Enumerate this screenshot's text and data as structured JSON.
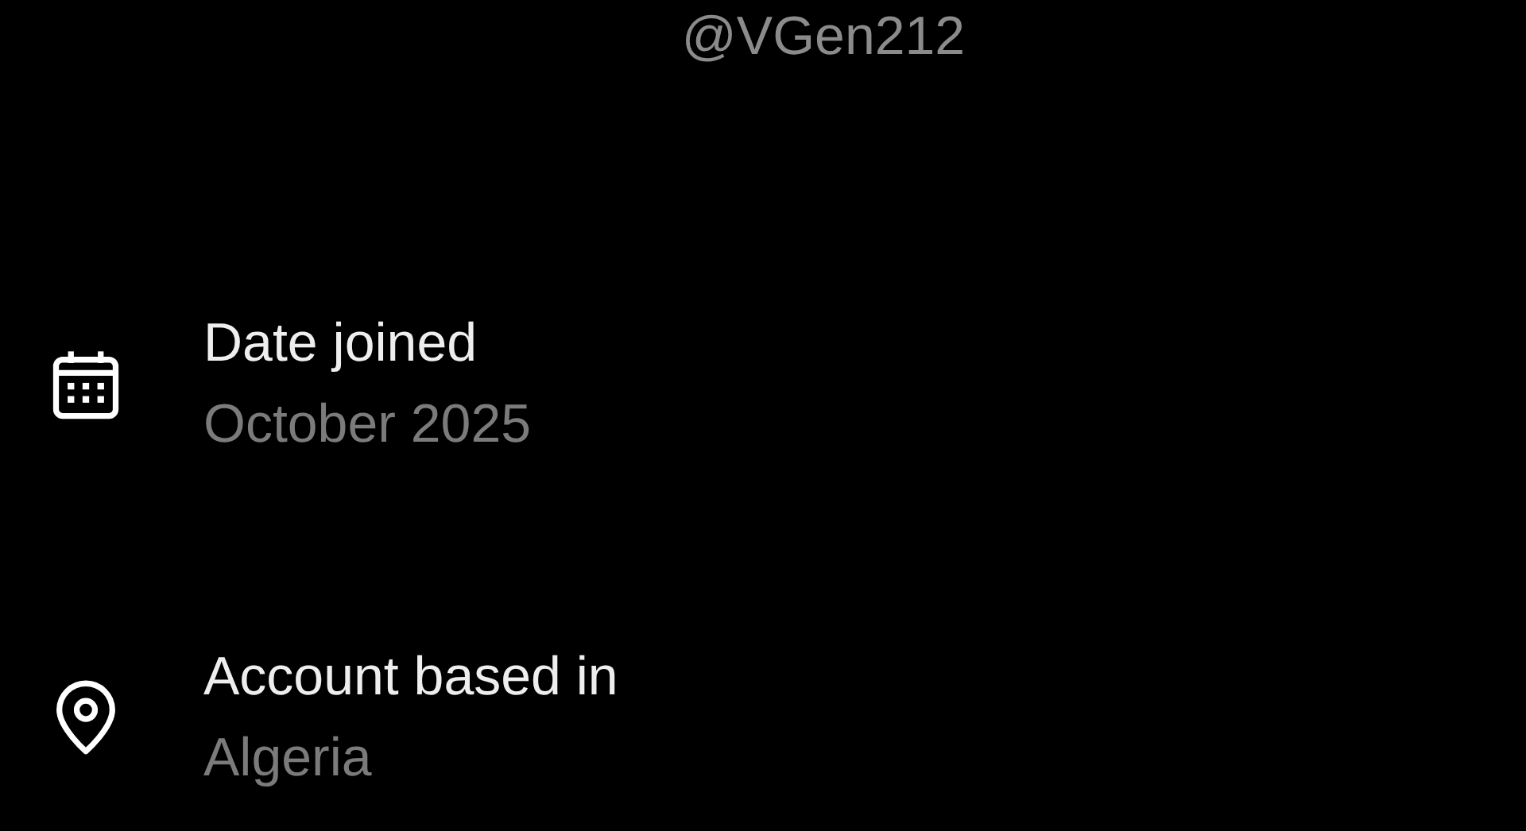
{
  "handle": "@VGen212",
  "items": [
    {
      "kind": "calendar",
      "label": "Date joined",
      "value": "October 2025"
    },
    {
      "kind": "location",
      "label": "Account based in",
      "value": "Algeria"
    }
  ]
}
